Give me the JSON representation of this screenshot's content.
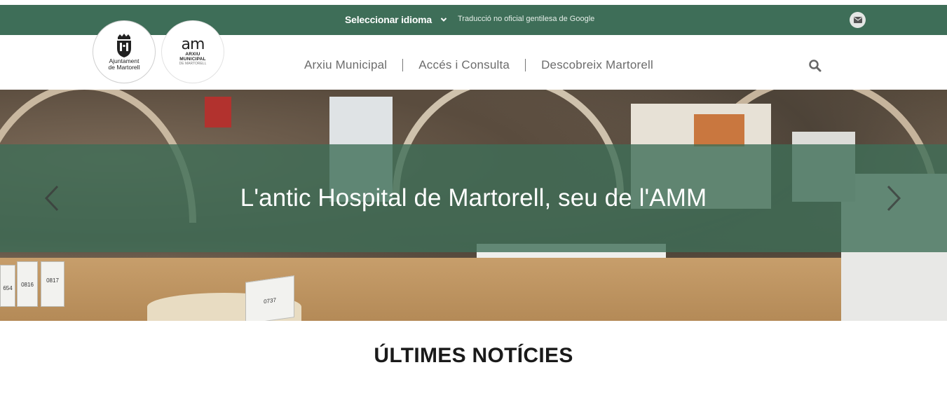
{
  "topbar": {
    "language_label": "Seleccionar idioma",
    "translation_note": "Traducció no oficial gentilesa de Google",
    "mail_icon": "envelope-icon"
  },
  "logos": {
    "ajuntament_line1": "Ajuntament",
    "ajuntament_line2": "de Martorell",
    "amm_mark": "am",
    "amm_line1": "ARXIU",
    "amm_line2": "MUNICIPAL",
    "amm_line3": "DE MARTORELL"
  },
  "nav": {
    "items": [
      {
        "label": "Arxiu Municipal"
      },
      {
        "label": "Accés i Consulta"
      },
      {
        "label": "Descobreix Martorell"
      }
    ],
    "search_icon": "search-icon"
  },
  "hero": {
    "caption": "L'antic Hospital de Martorell, seu de l'AMM",
    "prev_icon": "chevron-left-icon",
    "next_icon": "chevron-right-icon",
    "box_labels": [
      "0816",
      "0817",
      "0737",
      "654"
    ]
  },
  "news": {
    "heading": "ÚLTIMES NOTÍCIES"
  },
  "colors": {
    "brand_green": "#3e6e58",
    "banner_overlay": "rgba(62,110,88,0.80)",
    "nav_text": "#6c6c6c"
  }
}
